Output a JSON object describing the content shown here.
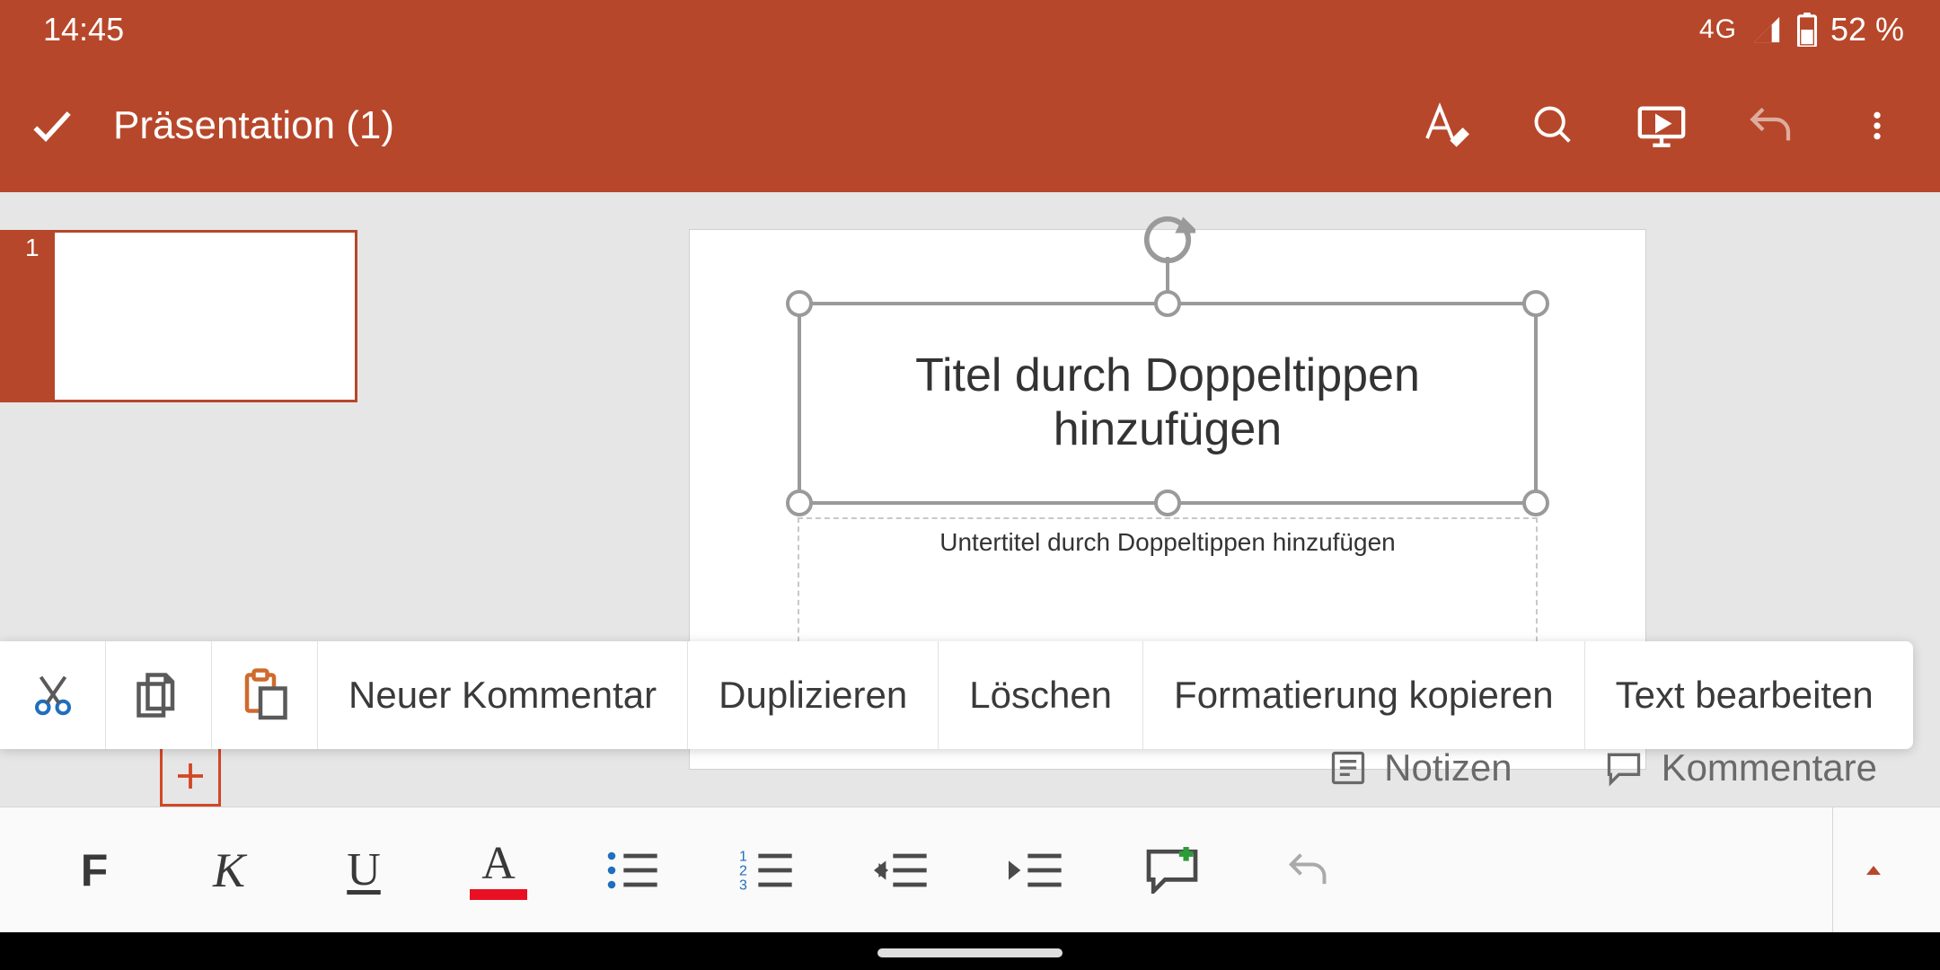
{
  "status": {
    "time": "14:45",
    "network": "4G",
    "battery": "52 %"
  },
  "header": {
    "title": "Präsentation (1)"
  },
  "slide": {
    "number": "1",
    "title_placeholder": "Titel durch Doppeltippen hinzufügen",
    "subtitle_placeholder": "Untertitel durch Doppeltippen hinzufügen"
  },
  "context_menu": {
    "new_comment": "Neuer Kommentar",
    "duplicate": "Duplizieren",
    "delete": "Löschen",
    "copy_format": "Formatierung kopieren",
    "edit_text": "Text bearbeiten"
  },
  "links": {
    "notes": "Notizen",
    "comments": "Kommentare"
  },
  "format": {
    "bold": "F",
    "italic": "K",
    "underline": "U",
    "fontcolor": "A"
  }
}
